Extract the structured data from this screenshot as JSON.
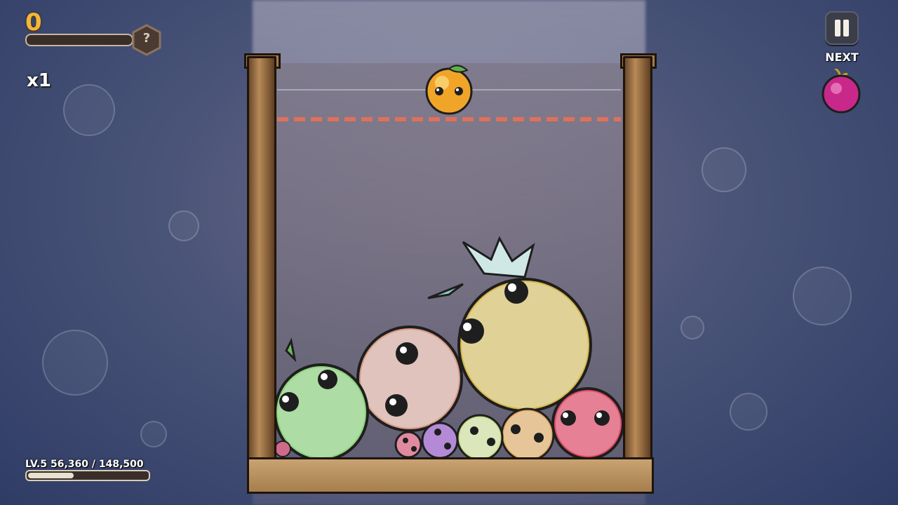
{
  "hud": {
    "score": "0",
    "badge_symbol": "?",
    "multiplier": "x1",
    "xp_progress": 0.0
  },
  "next": {
    "label": "NEXT",
    "fruit": "plum-icon"
  },
  "level": {
    "text": "LV.5 56,360 / 148,500",
    "progress": 0.38
  },
  "current_fruit": "orange-icon",
  "jar_fruits": [
    "pineapple",
    "peach",
    "pear",
    "apple",
    "persimmon",
    "lime",
    "grape",
    "cherry",
    "strawberry"
  ],
  "colors": {
    "score": "#f2b63a",
    "danger_line": "#e0705a",
    "wood": "#b88a58"
  }
}
